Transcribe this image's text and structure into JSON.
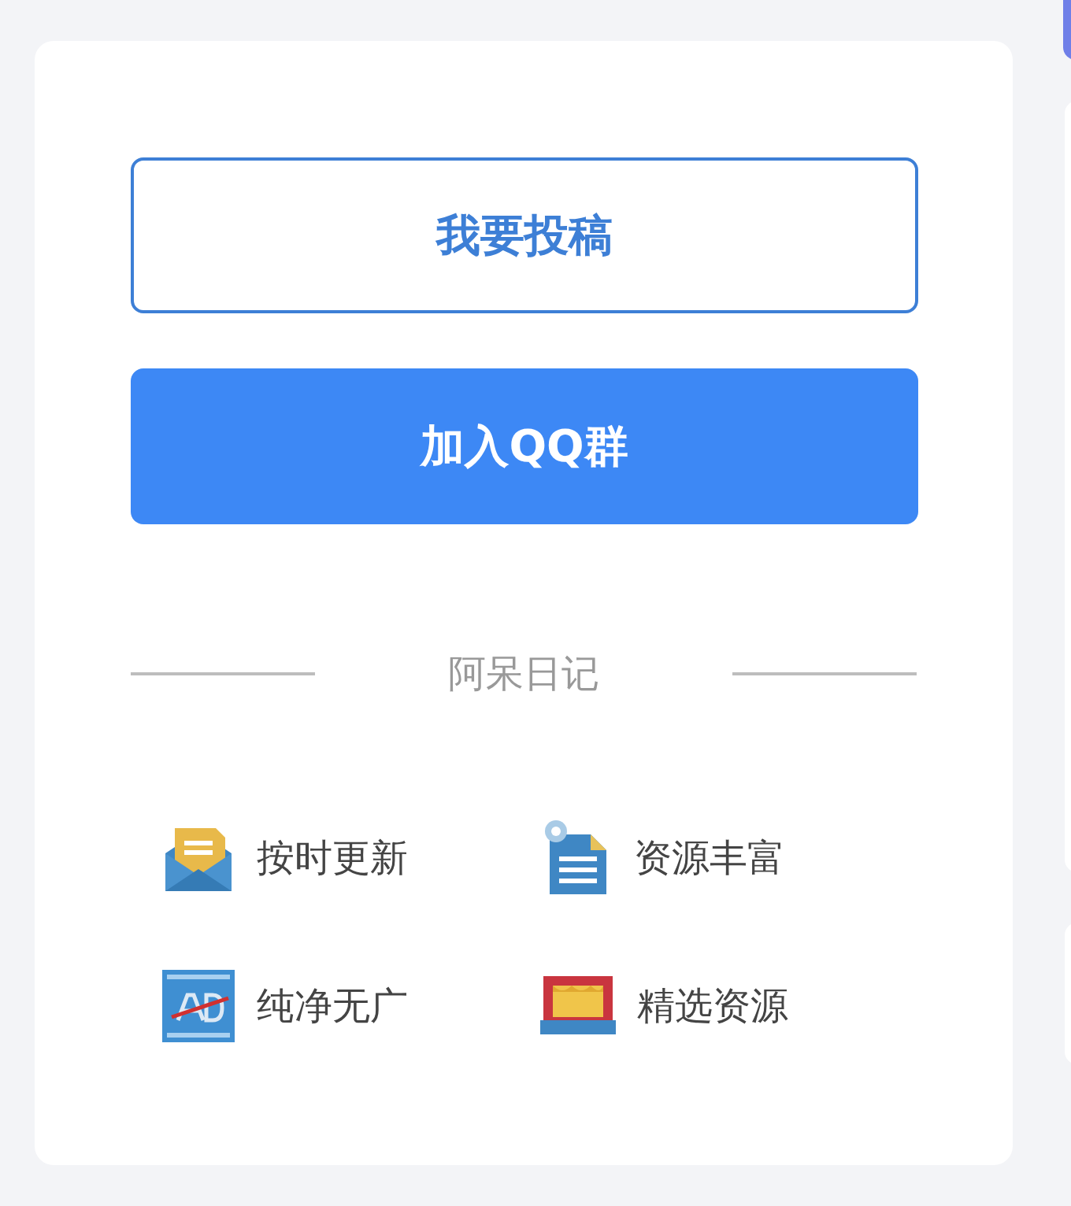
{
  "buttons": [
    {
      "label": "我要投稿",
      "kind": "outline"
    },
    {
      "label": "加入QQ群",
      "kind": "filled"
    }
  ],
  "divider": {
    "label": "阿呆日记"
  },
  "features": [
    {
      "label": "按时更新",
      "kind": "envelope"
    },
    {
      "label": "资源丰富",
      "kind": "document"
    },
    {
      "label": "纯净无广",
      "kind": "ad"
    },
    {
      "label": "精选资源",
      "kind": "stage"
    }
  ]
}
